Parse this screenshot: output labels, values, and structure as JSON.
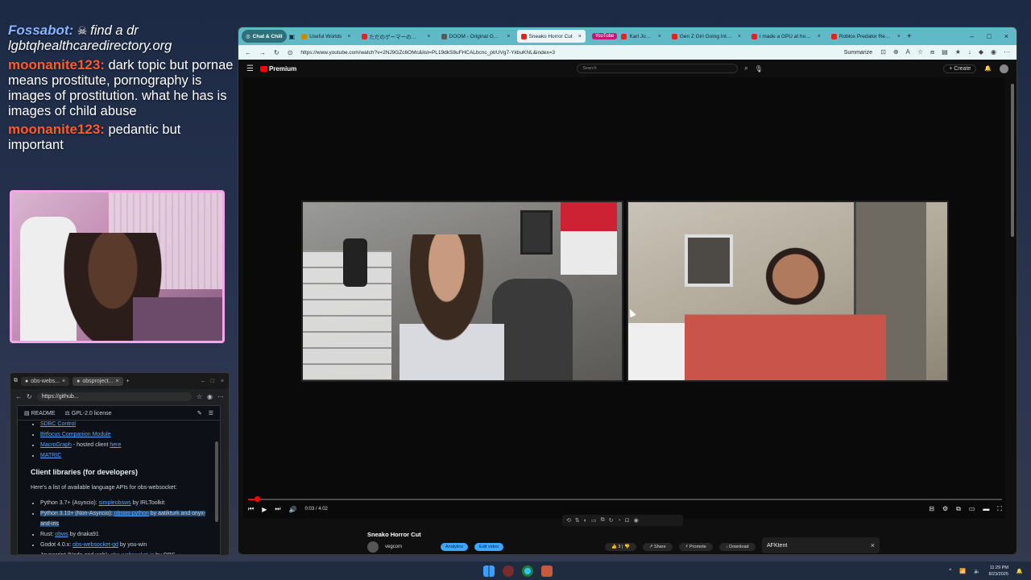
{
  "chat": [
    {
      "user": "Fossabot:",
      "icon": "skull-icon",
      "message": "find a dr lgbtqhealthcaredirectory.org",
      "style": "fossa"
    },
    {
      "user": "moonanite123:",
      "message": "dark topic but pornae means prostitute, pornography is images of prostitution. what he has is images of child abuse",
      "style": "moon"
    },
    {
      "user": "moonanite123:",
      "message": "pedantic but important",
      "style": "moon"
    }
  ],
  "mini_browser": {
    "tabs": [
      "obs-webs...",
      "obsproject..."
    ],
    "url": "https://github...",
    "readme_label": "README",
    "license_label": "GPL-2.0 license",
    "truncated_item": "SDBC Control",
    "tools": [
      {
        "name": "Bitfocus Companion Module",
        "suffix": ""
      },
      {
        "name": "MacroGraph",
        "suffix": " - hosted client ",
        "link": "here"
      },
      {
        "name": "MATRIC",
        "suffix": ""
      }
    ],
    "heading": "Client libraries (for developers)",
    "intro": "Here's a list of available language APIs for obs-websocket:",
    "libs": [
      {
        "prefix": "Python 3.7+ (Asyncio): ",
        "link": "simpleobsws",
        "suffix": " by IRLToolkit",
        "highlight": false
      },
      {
        "prefix": "Python 3.10+ (Non-Asyncio): ",
        "link": "obsws-python",
        "suffix": " by aatikturk and onyx-and-iris",
        "highlight": true
      },
      {
        "prefix": "Rust: ",
        "link": "obws",
        "suffix": " by dnaka91",
        "highlight": false
      },
      {
        "prefix": "Godot 4.0.x: ",
        "link": "obs-websocket-gd",
        "suffix": " by you-win",
        "highlight": false
      },
      {
        "prefix": "Javascript (Node and web): ",
        "link": "obs-websocket-js",
        "suffix": " by OBS",
        "highlight": false
      }
    ]
  },
  "browser": {
    "tab_group_label": "Chat & Chill",
    "tabs": [
      {
        "label": "Useful Worlds",
        "tag": "",
        "color": "#c58b00",
        "active": false
      },
      {
        "label": "ただのゲーマーのスーパー...",
        "tag": "",
        "color": "#e62117",
        "active": false
      },
      {
        "label": "DOOM - Original Game",
        "tag": "",
        "color": "#5a5a5a",
        "active": false
      },
      {
        "label": "Sneako Horror Cut",
        "tag": "",
        "color": "#e62117",
        "active": true
      },
      {
        "label": "Karl Jobst and Muttahar",
        "tag": "YouTube",
        "color": "#e62117",
        "active": false
      },
      {
        "label": "Gen Z Girl Going Into D...",
        "tag": "",
        "color": "#e62117",
        "active": false
      },
      {
        "label": "I made a GPU at home",
        "tag": "",
        "color": "#e62117",
        "active": false
      },
      {
        "label": "Roblox Predator Realize...",
        "tag": "",
        "color": "#e62117",
        "active": false
      }
    ],
    "url": "https://www.youtube.com/watch?v=2NJ9GZc6OMc&list=PL19dkS8uFHCALbcnc_ptrUVg7-YkbuKNL&index=3",
    "summarize_label": "Summarize"
  },
  "youtube": {
    "logo_text": "Premium",
    "search_placeholder": "Search",
    "create_label": "Create",
    "time": "0:03 / 4:02",
    "progress_fraction": 0.012,
    "video_title": "Sneako Horror Cut",
    "channel": "vegcom",
    "analytics_label": "Analytics",
    "edit_label": "Edit video",
    "like_count": "3",
    "share_label": "Share",
    "promote_label": "Promote",
    "download_label": "Download",
    "more_label": "...",
    "panel_title": "AFKtent"
  },
  "taskbar": {
    "time": "11:29 PM",
    "date": "8/23/2025"
  }
}
